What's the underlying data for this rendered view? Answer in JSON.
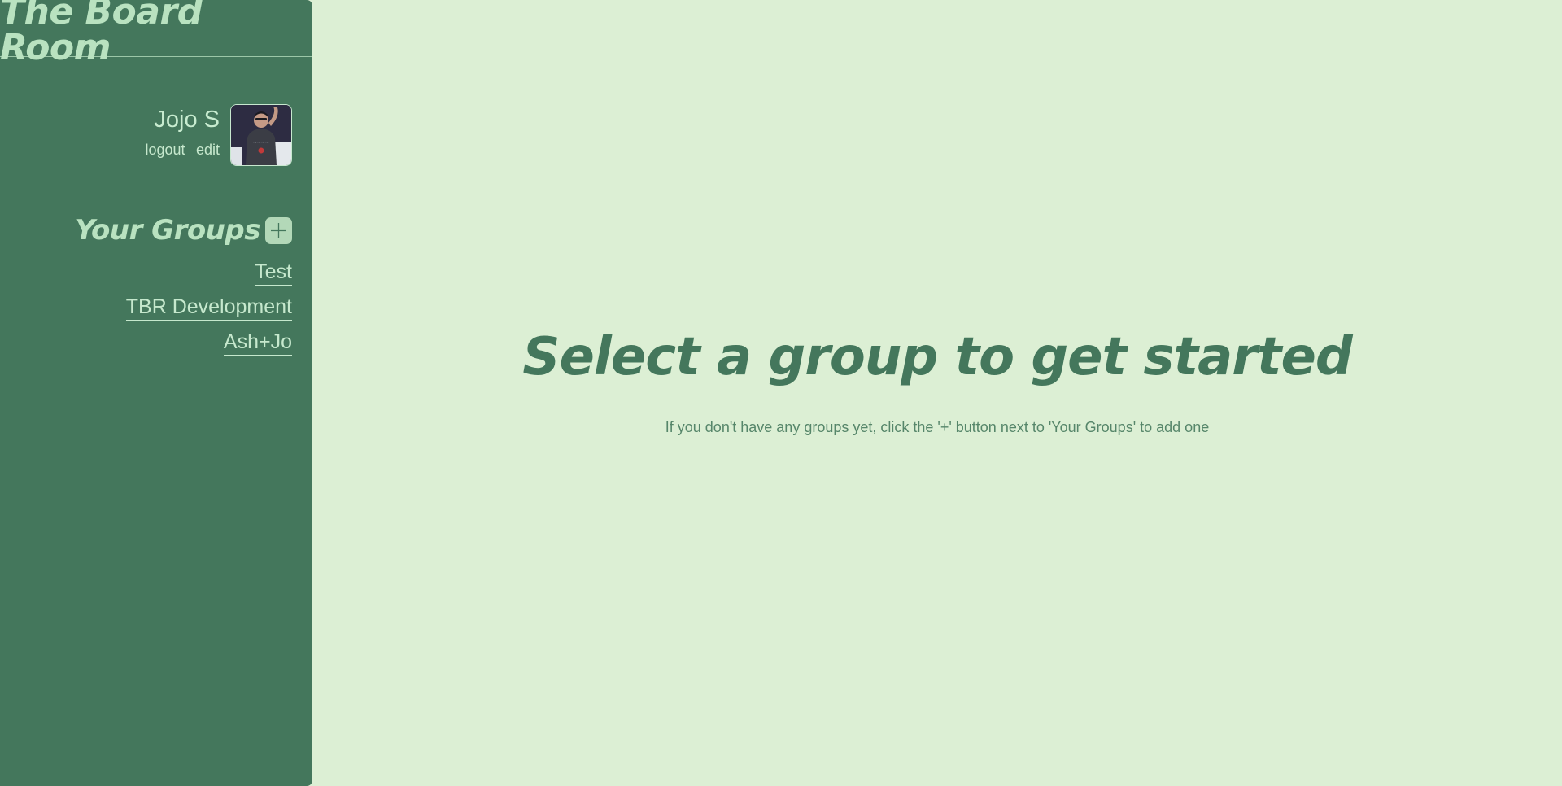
{
  "sidebar": {
    "brand_title": "The Board Room",
    "user": {
      "name": "Jojo S",
      "logout_label": "logout",
      "edit_label": "edit"
    },
    "groups_title": "Your Groups",
    "add_group_icon": "plus-icon",
    "groups": [
      {
        "label": "Test"
      },
      {
        "label": "TBR Development"
      },
      {
        "label": "Ash+Jo"
      }
    ]
  },
  "main": {
    "heading": "Select a group to get started",
    "hint": "If you don't have any groups yet, click the '+' button next to 'Your Groups' to add one"
  },
  "colors": {
    "sidebar_bg": "#44775c",
    "page_bg": "#dcefd4",
    "accent_light": "#b9e2c0",
    "accent_dark": "#44775c"
  }
}
